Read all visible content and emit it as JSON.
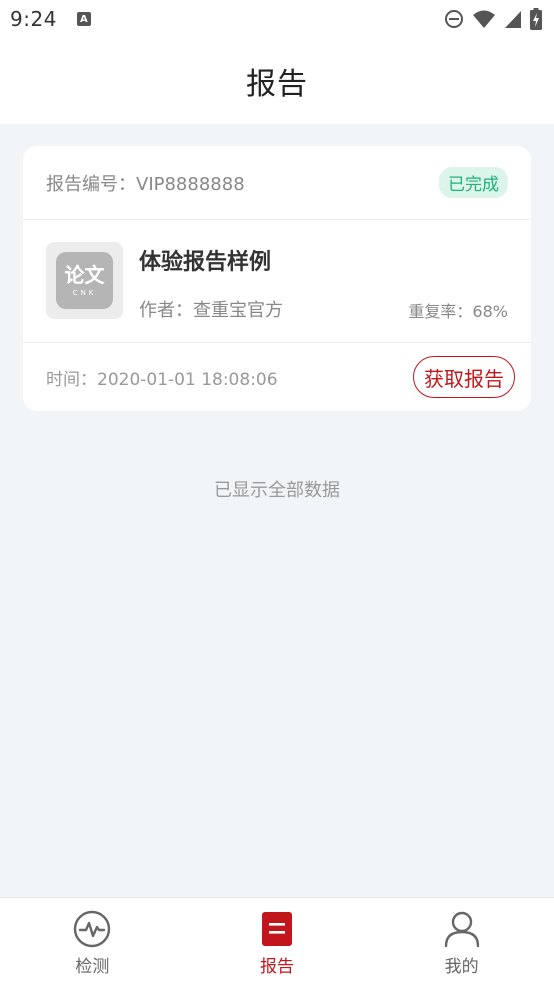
{
  "status_bar": {
    "time": "9:24",
    "notification_glyph": "A"
  },
  "header": {
    "title": "报告"
  },
  "report_card": {
    "report_no": "报告编号：VIP8888888",
    "status": "已完成",
    "thumb_logo": "论文",
    "thumb_sub": "CNK",
    "title": "体验报告样例",
    "author": "作者：查重宝官方",
    "repeat_rate": "重复率：68%",
    "time": "时间：2020-01-01 18:08:06",
    "get_report_label": "获取报告"
  },
  "end_text": "已显示全部数据",
  "bottom_nav": {
    "items": [
      {
        "label": "检测",
        "icon": "pulse-icon"
      },
      {
        "label": "报告",
        "icon": "report-icon",
        "active": true
      },
      {
        "label": "我的",
        "icon": "person-icon"
      }
    ]
  },
  "colors": {
    "accent": "#c0161c",
    "success": "#22b07d",
    "success_bg": "#dbf5ea",
    "background": "#f2f5f8"
  }
}
